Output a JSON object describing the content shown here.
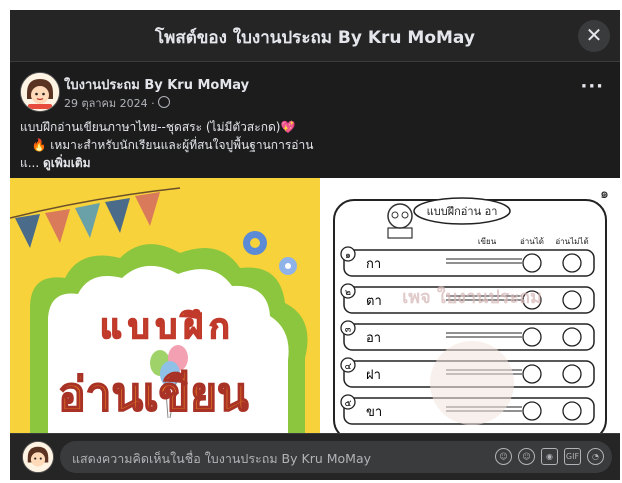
{
  "modal": {
    "title": "โพสต์ของ ใบงานประถม By Kru MoMay",
    "close_glyph": "✕"
  },
  "post": {
    "author": "ใบงานประถม By Kru MoMay",
    "date": "29 ตุลาคม 2024 ·",
    "more_glyph": "···",
    "caption_line1": "แบบฝึกอ่านเขียนภาษาไทย--ชุดสระ (ไม่มีตัวสะกด)",
    "caption_line1_emoji": "💖",
    "caption_line2_emoji": "🔥",
    "caption_line2": "เหมาะสำหรับนักเรียนและผู้ที่สนใจปูพื้นฐานการอ่าน",
    "caption_line3": "แ...",
    "see_more": "ดูเพิ่มเติม"
  },
  "cover_image": {
    "line1": "แบบฝึก",
    "line2": "อ่านเขียน"
  },
  "worksheet": {
    "page_number": "๑",
    "title": "แบบฝึกอ่าน อา",
    "col_write": "เขียน",
    "col_can_read": "อ่านได้",
    "col_cannot_read": "อ่านไม่ได้",
    "watermark": "เพจ ใบงานประถม",
    "rows": [
      {
        "num": "๑",
        "word": "กา"
      },
      {
        "num": "๒",
        "word": "ตา"
      },
      {
        "num": "๓",
        "word": "อา"
      },
      {
        "num": "๔",
        "word": "ฝา"
      },
      {
        "num": "๕",
        "word": "ขา"
      }
    ]
  },
  "comment_bar": {
    "placeholder": "แสดงความคิดเห็นในชื่อ ใบงานประถม By Kru MoMay",
    "icons": [
      "avatar-sticker-icon",
      "emoji-icon",
      "camera-icon",
      "gif-icon",
      "sticker-icon"
    ],
    "gif_label": "GIF"
  },
  "colors": {
    "modal_bg": "#1c1c1d",
    "text_primary": "#e4e6eb",
    "text_secondary": "#b0b3b8",
    "cover_yellow": "#f7d23a",
    "cover_green": "#8cc63f"
  }
}
